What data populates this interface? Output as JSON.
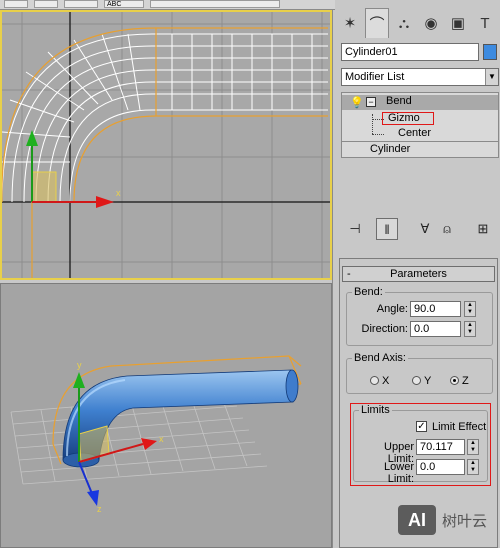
{
  "topbar": {
    "snippet": "ABC"
  },
  "command_panel": {
    "tabs": [
      {
        "icon": "create-icon",
        "glyph": "✶"
      },
      {
        "icon": "modify-icon",
        "glyph": "⌒"
      },
      {
        "icon": "hierarchy-icon",
        "glyph": "⛬"
      },
      {
        "icon": "motion-icon",
        "glyph": "◉"
      },
      {
        "icon": "display-icon",
        "glyph": "▣"
      },
      {
        "icon": "utilities-icon",
        "glyph": "T"
      }
    ],
    "object_name": "Cylinder01",
    "object_color": "#3d8be0",
    "modifier_list_label": "Modifier List",
    "stack": {
      "bend_label": "Bend",
      "gizmo_label": "Gizmo",
      "center_label": "Center",
      "base_label": "Cylinder"
    },
    "tools": [
      {
        "icon": "pin-stack-icon",
        "glyph": "⊣"
      },
      {
        "icon": "show-end-result-icon",
        "glyph": "‖"
      },
      {
        "icon": "make-unique-icon",
        "glyph": "∀"
      },
      {
        "icon": "remove-modifier-icon",
        "glyph": "⍝"
      },
      {
        "icon": "configure-sets-icon",
        "glyph": "⊞"
      }
    ],
    "parameters": {
      "header": "Parameters",
      "collapse": "-",
      "bend_group": "Bend:",
      "angle_label": "Angle:",
      "angle_value": "90.0",
      "direction_label": "Direction:",
      "direction_value": "0.0",
      "bend_axis_group": "Bend Axis:",
      "axis_x": "X",
      "axis_y": "Y",
      "axis_z": "Z",
      "axis_selected": "Z",
      "limits_group": "Limits",
      "limit_effect_label": "Limit Effect",
      "limit_effect_checked": true,
      "upper_limit_label": "Upper Limit:",
      "upper_limit_value": "70.117",
      "lower_limit_label": "Lower Limit:",
      "lower_limit_value": "0.0"
    }
  },
  "viewports": {
    "top": {
      "axis_label_x": "x",
      "border_color": "#e8d04a"
    },
    "perspective": {
      "axis_label_x": "x",
      "axis_label_y": "y",
      "axis_label_z": "z",
      "pipe_color": "#3a78c8"
    }
  },
  "watermark": {
    "logo": "AI",
    "text": "树叶云"
  }
}
